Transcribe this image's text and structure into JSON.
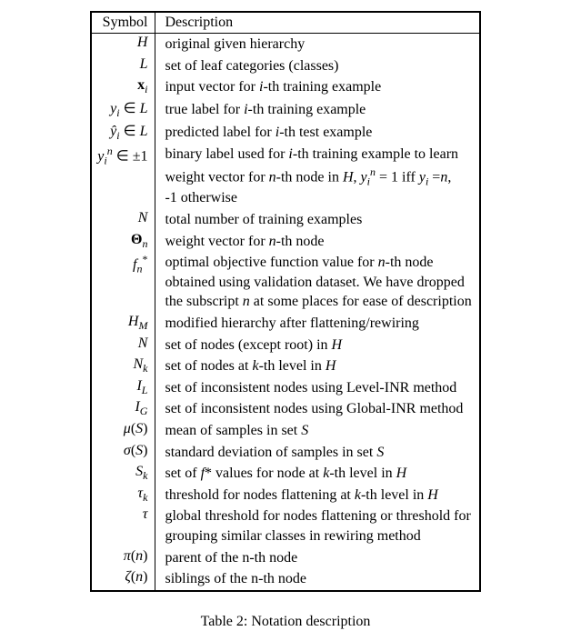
{
  "headers": {
    "symbol": "Symbol",
    "description": "Description"
  },
  "caption_prefix": "Table 2: ",
  "caption_text": "Notation description",
  "rows": [
    {
      "sym_html": "<span class='cal'>H</span>",
      "desc": "original given hierarchy"
    },
    {
      "sym_html": "<span class='cal'>L</span>",
      "desc": "set of leaf categories (classes)"
    },
    {
      "sym_html": "<b>x</b><sub><span class='it'>i</span></sub>",
      "desc_html": "input vector for <span class='it'>i</span>-th training example"
    },
    {
      "sym_html": "<span class='it'>y</span><sub><span class='it'>i</span></sub> ∈ <span class='cal'>L</span>",
      "desc_html": "true label for <span class='it'>i</span>-th training example"
    },
    {
      "sym_html": "<span class='it'>ŷ</span><sub><span class='it'>i</span></sub> ∈ <span class='cal'>L</span>",
      "desc_html": "predicted label for <span class='it'>i</span>-th test example"
    },
    {
      "sym_html": "<span class='it'>y</span><sub><span class='it'>i</span></sub><sup><span class='it'>n</span></sup> ∈ ±1",
      "desc_html": "binary label used for <span class='it'>i</span>-th training example to learn<br>weight vector for <span class='it'>n</span>-th node in <span class='cal'>H</span>, <span class='it'>y</span><sub><span class='it'>i</span></sub><sup><span class='it'>n</span></sup> = 1 iff <span class='it'>y</span><sub><span class='it'>i</span></sub> =<span class='it'>n</span>,<br>-1 otherwise"
    },
    {
      "sym_html": "<span class='it'>N</span>",
      "desc": "total number of training examples"
    },
    {
      "sym_html": "<b>Θ</b><sub><span class='it'>n</span></sub>",
      "desc_html": "weight vector for <span class='it'>n</span>-th node"
    },
    {
      "sym_html": "<span class='it'>f</span><sub><span class='it'>n</span></sub><sup>*</sup>",
      "desc_html": "optimal objective function value for <span class='it'>n</span>-th node<br>obtained using validation dataset. We have dropped<br>the subscript <span class='it'>n</span> at some places for ease of description"
    },
    {
      "sym_html": "<span class='cal'>H</span><sub><span class='it'>M</span></sub>",
      "desc": "modified hierarchy after flattening/rewiring"
    },
    {
      "sym_html": "<span class='cal'>N</span>",
      "desc_html": "set of nodes (except root) in <span class='cal'>H</span>"
    },
    {
      "sym_html": "<span class='cal'>N</span><sub><span class='it'>k</span></sub>",
      "desc_html": "set of nodes at <span class='it'>k</span>-th level in <span class='cal'>H</span>"
    },
    {
      "sym_html": "<span class='cal'>I</span><sub><span class='it'>L</span></sub>",
      "desc": "set of inconsistent nodes using Level-INR method"
    },
    {
      "sym_html": "<span class='cal'>I</span><sub><span class='it'>G</span></sub>",
      "desc": "set of inconsistent nodes using Global-INR method"
    },
    {
      "sym_html": "<span class='it'>μ</span>(<span class='cal'>S</span>)",
      "desc_html": "mean of samples in set <span class='cal'>S</span>"
    },
    {
      "sym_html": "<span class='it'>σ</span>(<span class='cal'>S</span>)",
      "desc_html": "standard deviation of samples in set <span class='cal'>S</span>"
    },
    {
      "sym_html": "<span class='cal'>S</span><sub><span class='it'>k</span></sub>",
      "desc_html": "set of <span class='it'>f</span>* values for node at <span class='it'>k</span>-th level in <span class='cal'>H</span>"
    },
    {
      "sym_html": "<span class='it'>τ</span><sub><span class='it'>k</span></sub>",
      "desc_html": "threshold for nodes flattening at <span class='it'>k</span>-th level in <span class='cal'>H</span>"
    },
    {
      "sym_html": "<span class='it'>τ</span>",
      "desc_html": "global threshold for nodes flattening or threshold for<br>grouping similar classes in rewiring method"
    },
    {
      "sym_html": "<span class='it'>π</span>(<span class='it'>n</span>)",
      "desc": "parent of the n-th node"
    },
    {
      "sym_html": "<span class='it'>ζ</span>(<span class='it'>n</span>)",
      "desc": "siblings of the n-th node"
    }
  ],
  "chart_data": {
    "type": "table",
    "title": "Table 2: Notation description",
    "columns": [
      "Symbol",
      "Description"
    ],
    "rows": [
      [
        "H (calligraphic)",
        "original given hierarchy"
      ],
      [
        "L (calligraphic)",
        "set of leaf categories (classes)"
      ],
      [
        "x_i (bold)",
        "input vector for i-th training example"
      ],
      [
        "y_i ∈ L",
        "true label for i-th training example"
      ],
      [
        "ŷ_i ∈ L",
        "predicted label for i-th test example"
      ],
      [
        "y_i^n ∈ ±1",
        "binary label used for i-th training example to learn weight vector for n-th node in H, y_i^n = 1 iff y_i = n, -1 otherwise"
      ],
      [
        "N",
        "total number of training examples"
      ],
      [
        "Θ_n (bold)",
        "weight vector for n-th node"
      ],
      [
        "f_n*",
        "optimal objective function value for n-th node obtained using validation dataset. We have dropped the subscript n at some places for ease of description"
      ],
      [
        "H_M (calligraphic)",
        "modified hierarchy after flattening/rewiring"
      ],
      [
        "N (calligraphic)",
        "set of nodes (except root) in H"
      ],
      [
        "N_k (calligraphic)",
        "set of nodes at k-th level in H"
      ],
      [
        "I_L (calligraphic)",
        "set of inconsistent nodes using Level-INR method"
      ],
      [
        "I_G (calligraphic)",
        "set of inconsistent nodes using Global-INR method"
      ],
      [
        "μ(S)",
        "mean of samples in set S"
      ],
      [
        "σ(S)",
        "standard deviation of samples in set S"
      ],
      [
        "S_k (calligraphic)",
        "set of f* values for node at k-th level in H"
      ],
      [
        "τ_k",
        "threshold for nodes flattening at k-th level in H"
      ],
      [
        "τ",
        "global threshold for nodes flattening or threshold for grouping similar classes in rewiring method"
      ],
      [
        "π(n)",
        "parent of the n-th node"
      ],
      [
        "ζ(n)",
        "siblings of the n-th node"
      ]
    ]
  }
}
